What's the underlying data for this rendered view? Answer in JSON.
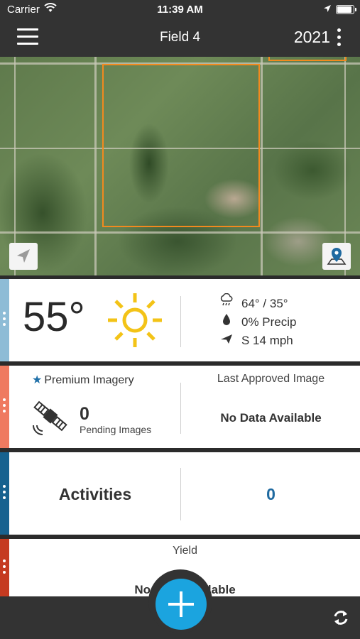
{
  "status_bar": {
    "carrier": "Carrier",
    "time": "11:39 AM"
  },
  "header": {
    "title": "Field 4",
    "year": "2021"
  },
  "map": {
    "field_boundary_color": "#f28a1e"
  },
  "weather": {
    "temperature": "55°",
    "high_low": "64° /  35°",
    "precip": "0% Precip",
    "wind": "S 14 mph",
    "accent": "#8ebcd6",
    "icon": "sun-icon"
  },
  "imagery": {
    "premium_label": "Premium Imagery",
    "pending_count": "0",
    "pending_label": "Pending Images",
    "last_label": "Last Approved Image",
    "last_value": "No Data Available",
    "accent": "#ef7a60"
  },
  "activities": {
    "label": "Activities",
    "count": "0",
    "accent": "#17628f"
  },
  "yield": {
    "label": "Yield",
    "value": "No Data Available",
    "accent": "#c53a20"
  },
  "fab_color": "#1ba4df"
}
